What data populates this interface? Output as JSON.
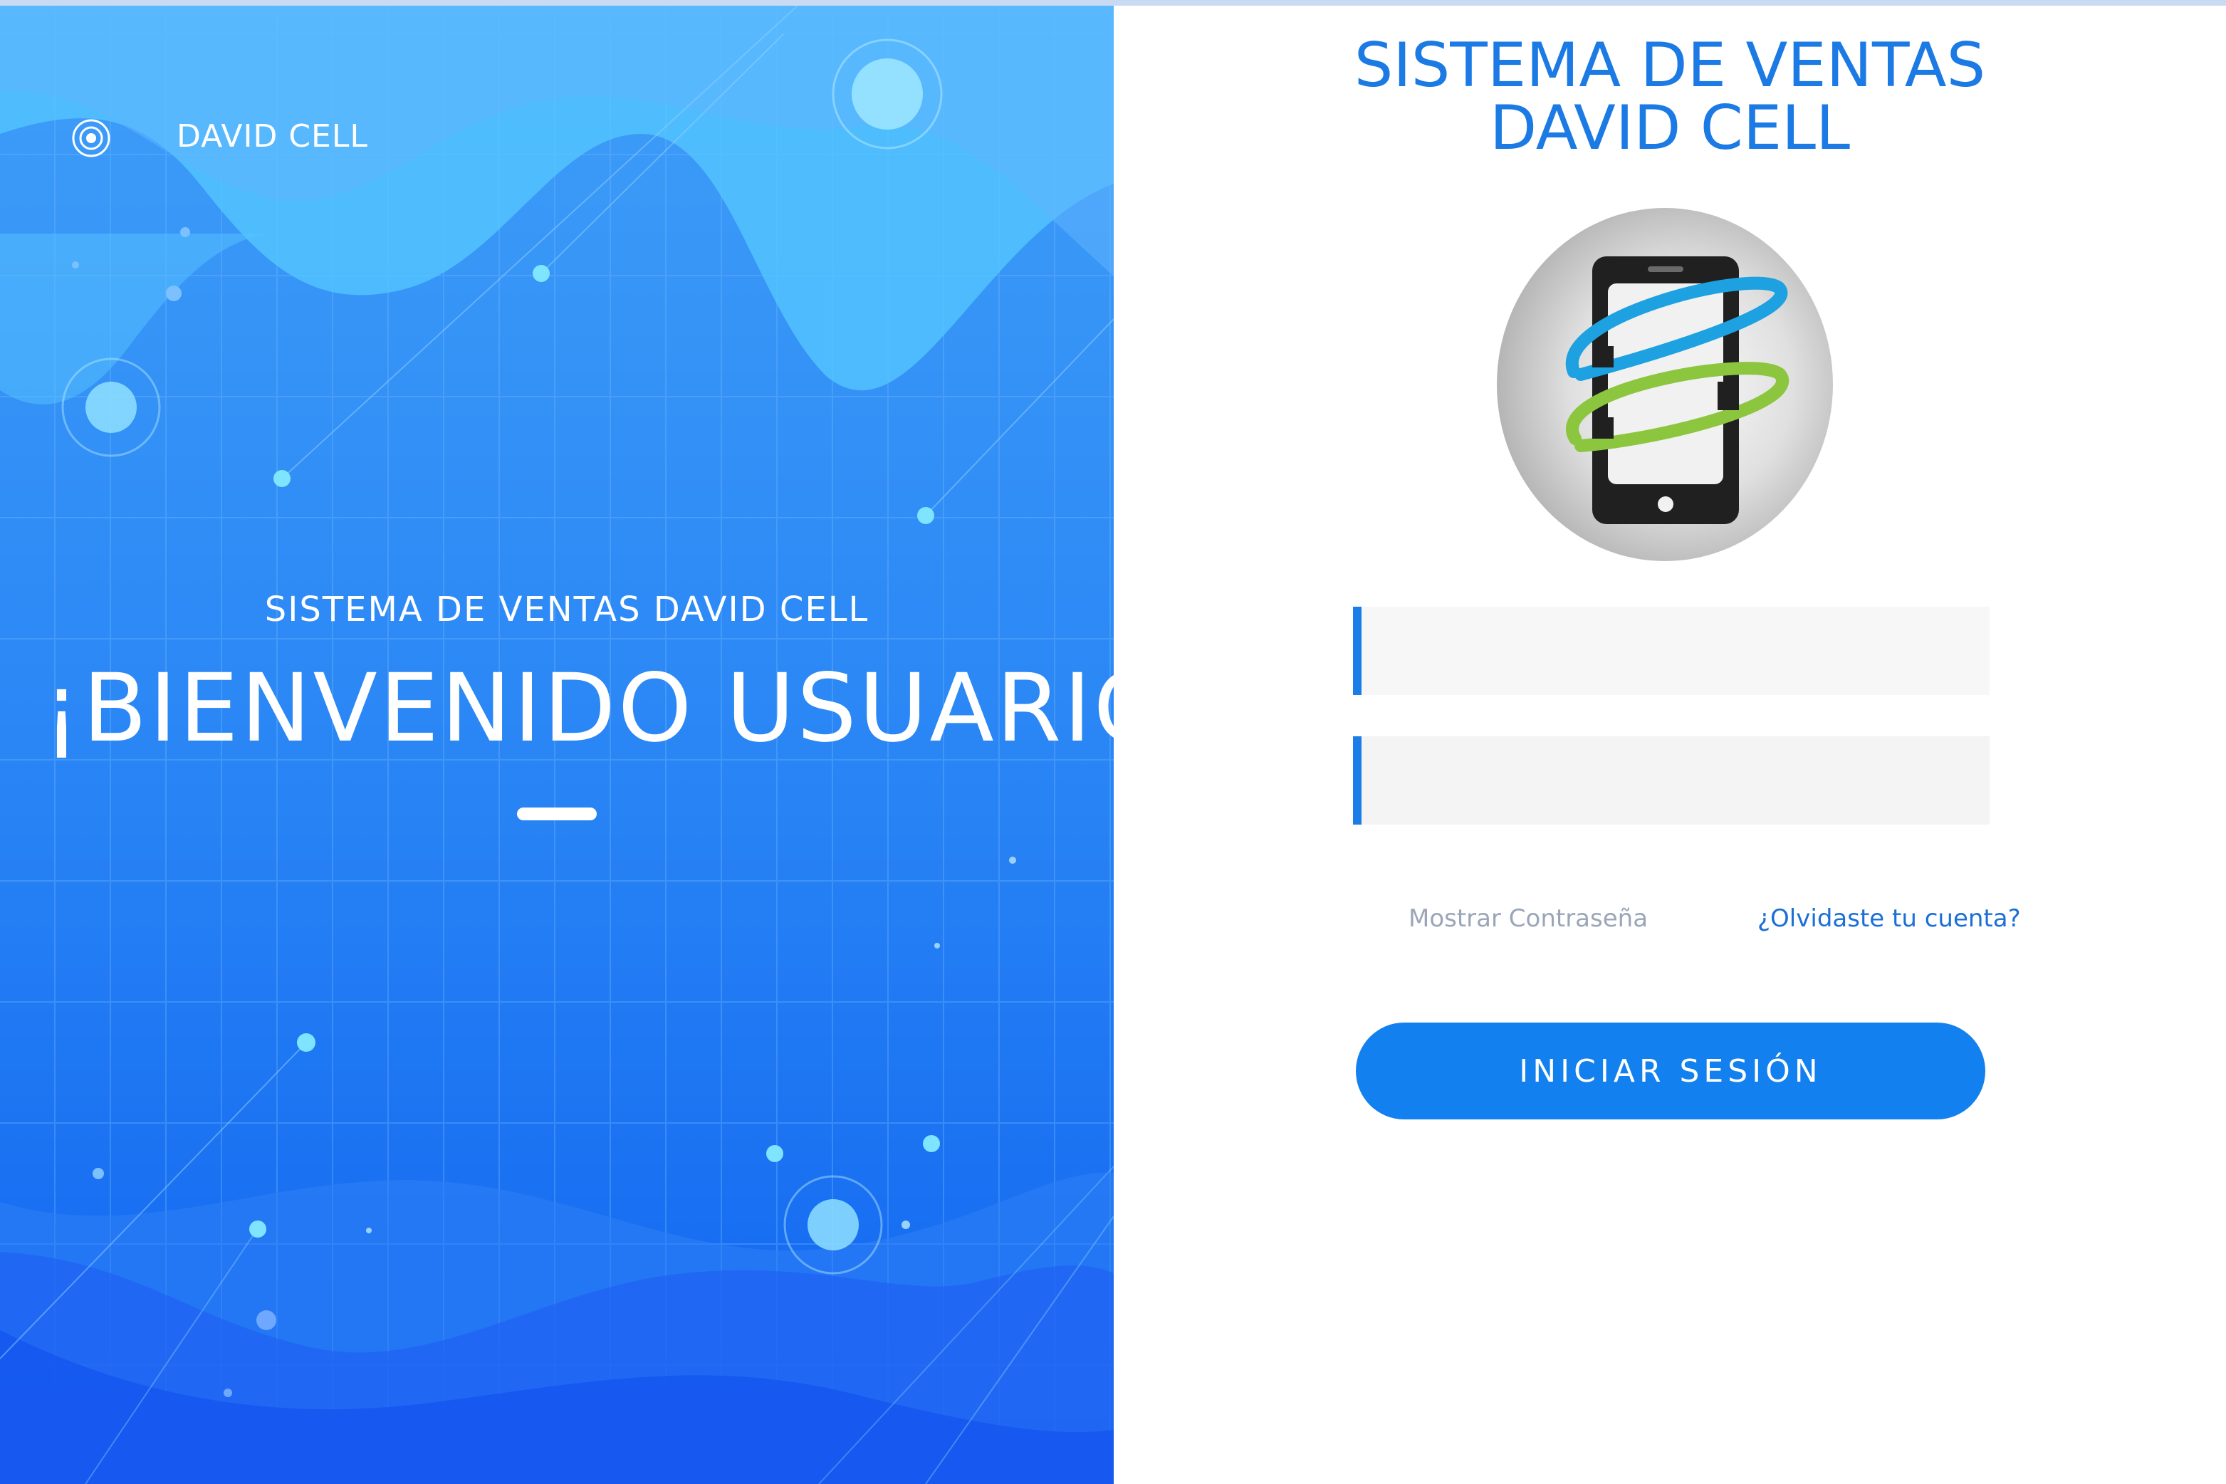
{
  "hero": {
    "brand_name": "DAVID CELL",
    "subtitle": "SISTEMA DE VENTAS DAVID CELL",
    "title": "¡BIENVENIDO USUARIO!"
  },
  "login": {
    "title_line1": "SISTEMA DE VENTAS",
    "title_line2": "DAVID CELL",
    "username": {
      "value": "",
      "placeholder": ""
    },
    "password": {
      "value": "",
      "placeholder": ""
    },
    "show_password_label": "Mostrar Contraseña",
    "forgot_label": "¿Olvidaste tu cuenta?",
    "submit_label": "INICIAR SESIÓN"
  },
  "colors": {
    "accent": "#1380ef",
    "title_blue": "#1b7ae4",
    "hero_top": "#3a97f7",
    "hero_bottom": "#0d5ef0"
  }
}
